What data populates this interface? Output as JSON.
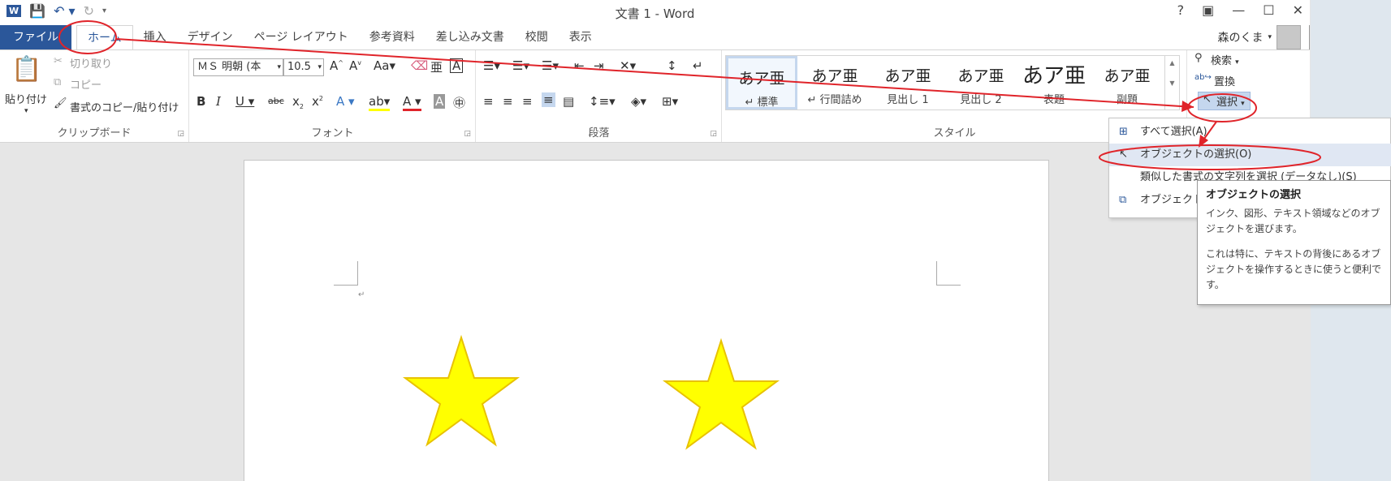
{
  "window": {
    "title": "文書 1 - Word",
    "controls": [
      "?",
      "▣",
      "—",
      "☐",
      "✕"
    ]
  },
  "tabs": [
    "ファイル",
    "ホーム",
    "挿入",
    "デザイン",
    "ページ レイアウト",
    "参考資料",
    "差し込み文書",
    "校閲",
    "表示"
  ],
  "user": {
    "name": "森のくま"
  },
  "clipboard": {
    "label": "クリップボード",
    "paste": "貼り付け",
    "cut": "切り取り",
    "copy": "コピー",
    "format_painter": "書式のコピー/貼り付け"
  },
  "font": {
    "label": "フォント",
    "name": "ＭＳ 明朝 (本",
    "size": "10.5"
  },
  "paragraph": {
    "label": "段落"
  },
  "styles": {
    "label": "スタイル",
    "items": [
      {
        "sample": "あア亜",
        "name": "↵ 標準"
      },
      {
        "sample": "あア亜",
        "name": "↵ 行間詰め"
      },
      {
        "sample": "あア亜",
        "name": "見出し 1"
      },
      {
        "sample": "あア亜",
        "name": "見出し 2"
      },
      {
        "sample": "あア亜",
        "name": "表題"
      },
      {
        "sample": "あア亜",
        "name": "副題"
      }
    ]
  },
  "editing": {
    "find": "検索",
    "replace": "置換",
    "select": "選択"
  },
  "select_menu": {
    "items": [
      "すべて選択(A)",
      "オブジェクトの選択(O)",
      "類似した書式の文字列を選択 (データなし)(S)",
      "オブジェクトの選択と表示(P)..."
    ]
  },
  "tooltip": {
    "title": "オブジェクトの選択",
    "line1": "インク、図形、テキスト領域などのオブジェクトを選びます。",
    "line2": "これは特に、テキストの背後にあるオブジェクトを操作するときに使うと便利です。"
  },
  "colors": {
    "accent": "#2b579a",
    "star_fill": "#ffff00",
    "star_stroke": "#e8c200",
    "annotation": "#e0242a"
  }
}
